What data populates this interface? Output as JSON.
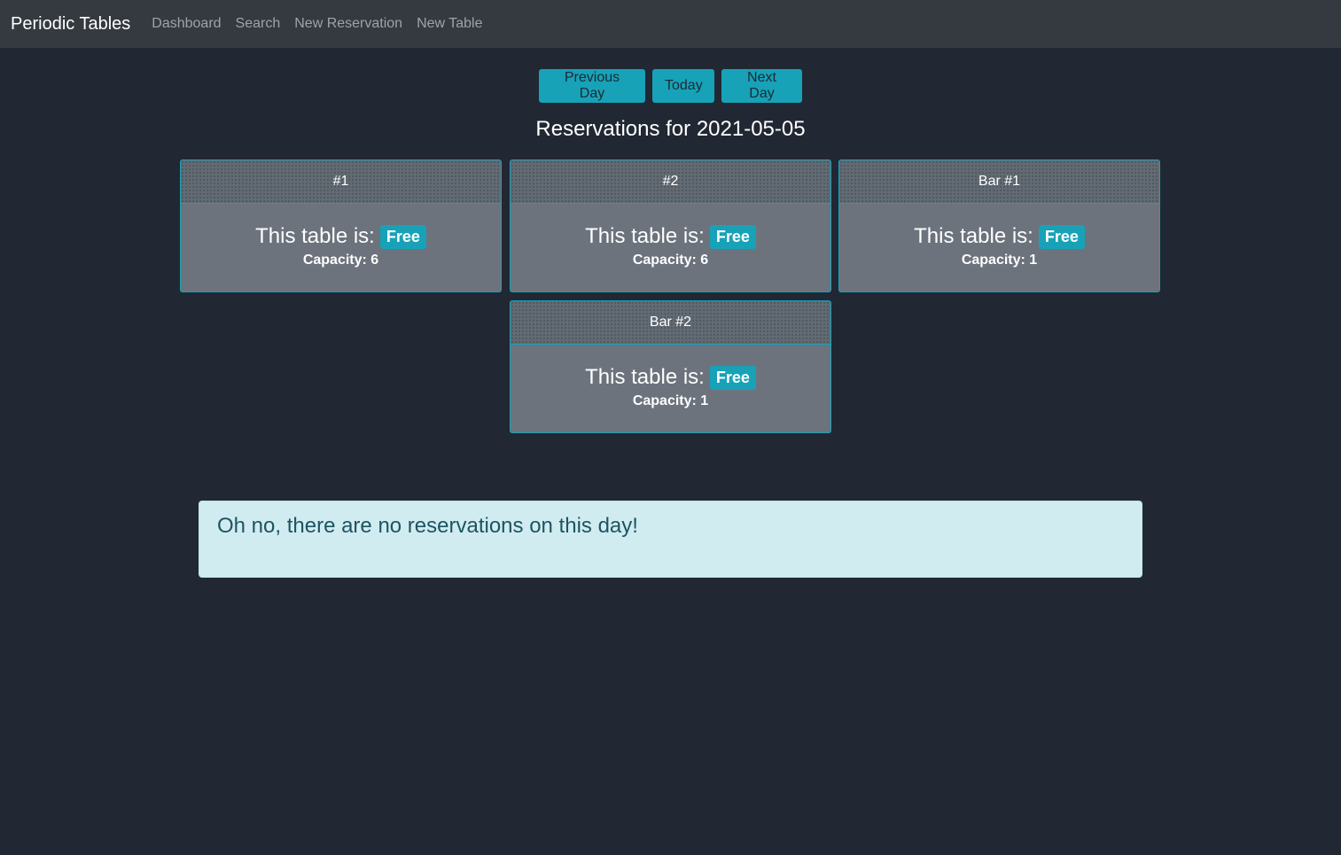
{
  "navbar": {
    "brand": "Periodic Tables",
    "links": [
      "Dashboard",
      "Search",
      "New Reservation",
      "New Table"
    ]
  },
  "day_nav": {
    "previous_label": "Previous Day",
    "today_label": "Today",
    "next_label": "Next Day"
  },
  "page_title": "Reservations for 2021-05-05",
  "status_prefix": "This table is:",
  "tables": [
    {
      "name": "#1",
      "status": "Free",
      "capacity": "Capacity: 6"
    },
    {
      "name": "#2",
      "status": "Free",
      "capacity": "Capacity: 6"
    },
    {
      "name": "Bar #1",
      "status": "Free",
      "capacity": "Capacity: 1"
    },
    {
      "name": "Bar #2",
      "status": "Free",
      "capacity": "Capacity: 1"
    }
  ],
  "alert": {
    "message": "Oh no, there are no reservations on this day!"
  },
  "colors": {
    "accent": "#17a2b8",
    "background": "#212833",
    "navbar": "#343a40",
    "card": "#6c737d",
    "alert_background": "#d1ecf1",
    "alert_text": "#1d5460"
  }
}
